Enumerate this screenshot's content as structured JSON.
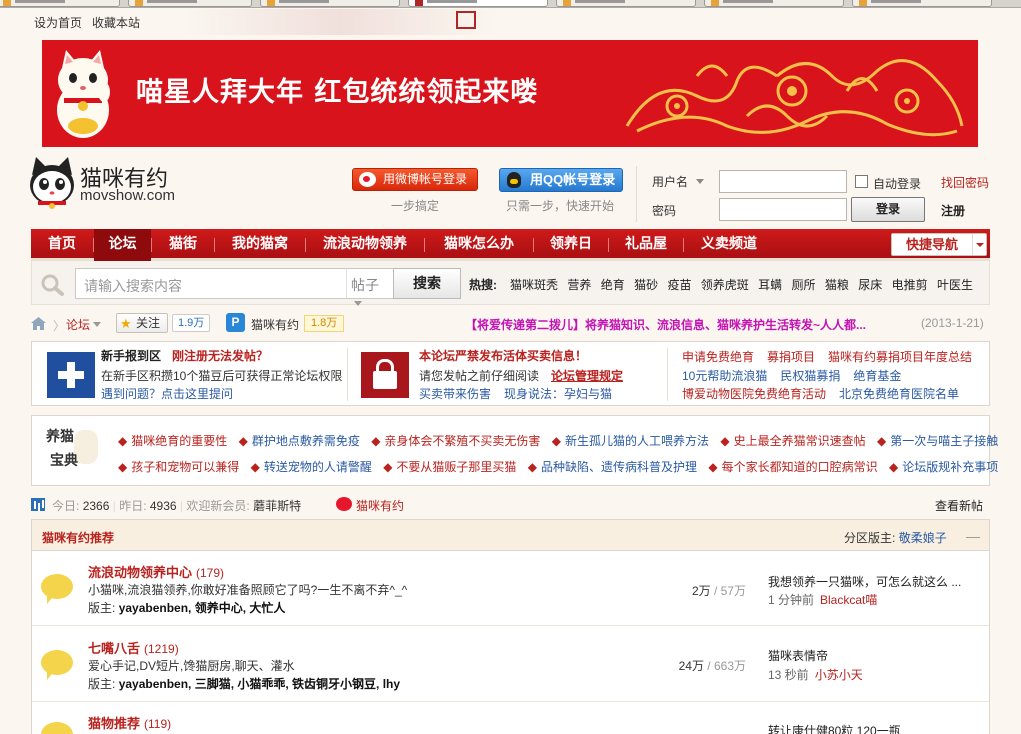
{
  "top": {
    "links": [
      "设为首页",
      "收藏本站"
    ]
  },
  "banner": {
    "slogan": "喵星人拜大年 红包统统领起来喽"
  },
  "logo": {
    "name": "猫咪有约",
    "domain": "movshow.com"
  },
  "login": {
    "weibo_label": "用微博帐号登录",
    "weibo_sub": "一步搞定",
    "qq_label": "用QQ帐号登录",
    "qq_sub": "只需一步，快速开始",
    "username_label": "用户名",
    "password_label": "密码",
    "username_value": "",
    "password_value": "",
    "auto_login": "自动登录",
    "find_password": "找回密码",
    "login_button": "登录",
    "register": "注册"
  },
  "nav": {
    "items": [
      "首页",
      "论坛",
      "猫街",
      "我的猫窝",
      "流浪动物领养",
      "猫咪怎么办",
      "领养日",
      "礼品屋",
      "义卖频道"
    ],
    "active": "论坛",
    "quick_nav": "快捷导航"
  },
  "search": {
    "placeholder": "请输入搜索内容",
    "type": "帖子",
    "button": "搜索",
    "hot_label": "热搜:",
    "hot_words": [
      "猫咪斑秃",
      "营养",
      "绝育",
      "猫砂",
      "疫苗",
      "领养虎斑",
      "耳螨",
      "厕所",
      "猫粮",
      "尿床",
      "电推剪",
      "叶医生"
    ]
  },
  "crumb": {
    "forum": "论坛",
    "follow": "关注",
    "follow_count": "1.9万",
    "app_icon_letter": "P",
    "app_name": "猫咪有约",
    "app_count": "1.8万",
    "notice": "【将爱传递第二拨儿】将养猫知识、流浪信息、猫咪养护生活转发~人人都...",
    "notice_date": "(2013-1-21)"
  },
  "info": {
    "box1_title": "新手报到区",
    "box1_title_red": "刚注册无法发帖？",
    "box1_line1": "在新手区积攒10个猫豆后可获得正常论坛权限",
    "box1_line2": "遇到问题？点击这里提问",
    "box2_title": "本论坛严禁发布活体买卖信息！",
    "box2_line1": "请您发帖之前仔细阅读",
    "box2_line1_link": "论坛管理规定",
    "box2_line2a": "买卖带来伤害",
    "box2_line2b": "现身说法：孕妇与猫",
    "right_rows": [
      [
        {
          "t": "申请免费绝育",
          "c": "red"
        },
        {
          "t": "募捐项目",
          "c": "red"
        },
        {
          "t": "猫咪有约募捐项目年度总结",
          "c": "red"
        }
      ],
      [
        {
          "t": "10元帮助流浪猫",
          "c": "blue"
        },
        {
          "t": "民权猫募捐",
          "c": "blue"
        },
        {
          "t": "绝育基金",
          "c": "blue"
        }
      ],
      [
        {
          "t": "博爱动物医院免费绝育活动",
          "c": "red"
        },
        {
          "t": "北京免费绝育医院名单",
          "c": "blue"
        }
      ]
    ]
  },
  "knowledge": {
    "logo_line1": "养猫",
    "logo_line2": "宝典",
    "row1": [
      {
        "t": "猫咪绝育的重要性",
        "c": "red"
      },
      {
        "t": "群护地点敷养需免疫",
        "c": "blue"
      },
      {
        "t": "亲身体会不繁殖不买卖无伤害",
        "c": "red"
      },
      {
        "t": "新生孤儿猫的人工喂养方法",
        "c": "blue"
      },
      {
        "t": "史上最全养猫常识速查帖",
        "c": "red"
      },
      {
        "t": "第一次与喵主子接触",
        "c": "blue"
      }
    ],
    "row2": [
      {
        "t": "孩子和宠物可以兼得",
        "c": "red"
      },
      {
        "t": "转送宠物的人请警醒",
        "c": "blue"
      },
      {
        "t": "不要从猫贩子那里买猫",
        "c": "red"
      },
      {
        "t": "品种缺陷、遗传病科普及护理",
        "c": "blue"
      },
      {
        "t": "每个家长都知道的口腔病常识",
        "c": "red"
      },
      {
        "t": "论坛版规补充事项",
        "c": "blue"
      }
    ]
  },
  "stats": {
    "today_label": "今日:",
    "today": "2366",
    "yesterday_label": "昨日:",
    "yesterday": "4936",
    "welcome_label": "欢迎新会员:",
    "new_member": "蘑菲斯特",
    "weibo_name": "猫咪有约",
    "view_new": "查看新帖"
  },
  "forum": {
    "section_title": "猫咪有约推荐",
    "moderator_label": "分区版主:",
    "moderator": "敬柔娘子",
    "close": "—",
    "boards": [
      {
        "name": "流浪动物领养中心",
        "count": "(179)",
        "desc": "小猫咪,流浪猫领养,你敢好准备照顾它了吗?一生不离不弃^_^",
        "mods_label": "版主:",
        "mods": "yayabenben, 领养中心, 大忙人",
        "threads": "2万",
        "posts": "/ 57万",
        "last_title": "我想领养一只猫咪，可怎么就这么 ...",
        "last_time": "1 分钟前",
        "last_user": "Blackcat喵"
      },
      {
        "name": "七嘴八舌",
        "count": "(1219)",
        "desc": "爱心手记,DV短片,馋猫厨房,聊天、灌水",
        "mods_label": "版主:",
        "mods": "yayabenben, 三脚猫, 小猫乖乖, 铁齿铜牙小钢豆, lhy",
        "threads": "24万",
        "posts": "/ 663万",
        "last_title": "猫咪表情帝",
        "last_time": "13 秒前",
        "last_user": "小苏小天"
      },
      {
        "name": "猫物推荐",
        "count": "(119)",
        "desc": "",
        "mods_label": "",
        "mods": "",
        "threads": "",
        "posts": "",
        "last_title": "转让康仕健80粒 120一瓶",
        "last_time": "",
        "last_user": ""
      }
    ]
  }
}
